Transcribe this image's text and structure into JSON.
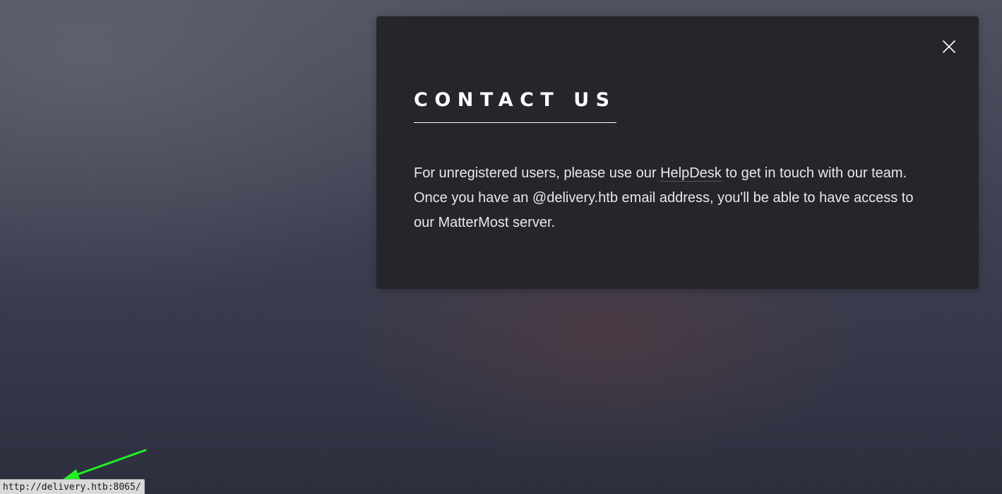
{
  "modal": {
    "title": "CONTACT US",
    "close_icon": "close-icon",
    "body": {
      "before_link": "For unregistered users, please use our ",
      "link_text": "HelpDesk",
      "after_link": " to get in touch with our team. Once you have an @delivery.htb email address, you'll be able to have access to our MatterMost server."
    }
  },
  "annotation": {
    "icon": "arrow-icon",
    "color": "#22ee22"
  },
  "status_bar": {
    "url": "http://delivery.htb:8065/"
  },
  "colors": {
    "modal_background": "#24252a",
    "text": "#ffffff",
    "arrow": "#22ee22"
  }
}
